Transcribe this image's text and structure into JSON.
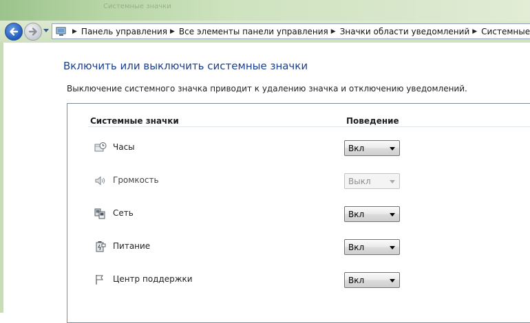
{
  "window": {
    "title": "Системные значки"
  },
  "address_bar": {
    "crumbs": [
      "Панель управления",
      "Все элементы панели управления",
      "Значки области уведомлений",
      "Системные значки"
    ]
  },
  "page": {
    "title": "Включить или выключить системные значки",
    "description": "Выключение системного значка приводит к удалению значка и отключению уведомлений."
  },
  "table": {
    "col_name": "Системные значки",
    "col_behavior": "Поведение",
    "rows": [
      {
        "icon": "clock-icon",
        "label": "Часы",
        "value": "Вкл",
        "enabled": true
      },
      {
        "icon": "volume-icon",
        "label": "Громкость",
        "value": "Выкл",
        "enabled": false
      },
      {
        "icon": "network-icon",
        "label": "Сеть",
        "value": "Вкл",
        "enabled": true
      },
      {
        "icon": "power-icon",
        "label": "Питание",
        "value": "Вкл",
        "enabled": true
      },
      {
        "icon": "action-center-flag-icon",
        "label": "Центр поддержки",
        "value": "Вкл",
        "enabled": true
      }
    ]
  }
}
